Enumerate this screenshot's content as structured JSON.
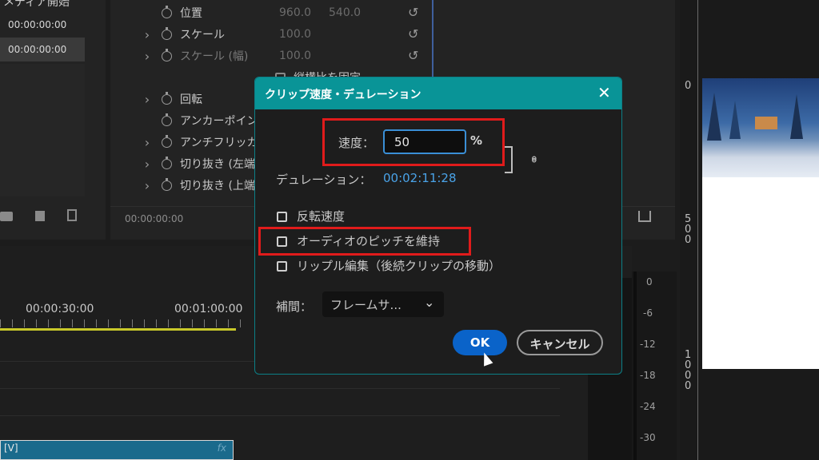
{
  "source": {
    "header": "メディア開始",
    "times": [
      "00:00:00:00",
      "00:00:00:00"
    ]
  },
  "effect_controls": {
    "rows": [
      {
        "label": "位置",
        "value": "960.0",
        "value2": "540.0"
      },
      {
        "label": "スケール",
        "value": "100.0"
      },
      {
        "label": "スケール (幅)",
        "value": "100.0"
      },
      {
        "label": "縦横比を固定",
        "value": ""
      },
      {
        "label": "回転",
        "value": ""
      },
      {
        "label": "アンカーポイント",
        "value": ""
      },
      {
        "label": "アンチフリッカー",
        "value": ""
      },
      {
        "label": "切り抜き (左端)",
        "value": ""
      },
      {
        "label": "切り抜き (上端)",
        "value": ""
      }
    ],
    "footer_time": "00:00:00:00"
  },
  "timeline": {
    "ruler": [
      "00:00:30:00",
      "00:01:00:00"
    ],
    "clip_label": "[V]",
    "clip_fx": "fx"
  },
  "meter": {
    "labels": [
      "0",
      "-6",
      "-12",
      "-18",
      "-24",
      "-30"
    ]
  },
  "program": {
    "ruler": [
      "0",
      "500",
      "1000"
    ]
  },
  "dialog": {
    "title": "クリップ速度・デュレーション",
    "speed_label": "速度：",
    "speed_value": "50",
    "speed_unit": "%",
    "duration_label": "デュレーション：",
    "duration_value": "00:02:11:28",
    "reverse_label": "反転速度",
    "pitch_label": "オーディオのピッチを維持",
    "ripple_label": "リップル編集（後続クリップの移動）",
    "interp_label": "補間：",
    "interp_value": "フレームサ...",
    "ok": "OK",
    "cancel": "キャンセル"
  },
  "colors": {
    "accent": "#099497",
    "ok_button": "#0a63c9",
    "highlight": "#e01b1b",
    "link_blue": "#4aa3e8"
  }
}
